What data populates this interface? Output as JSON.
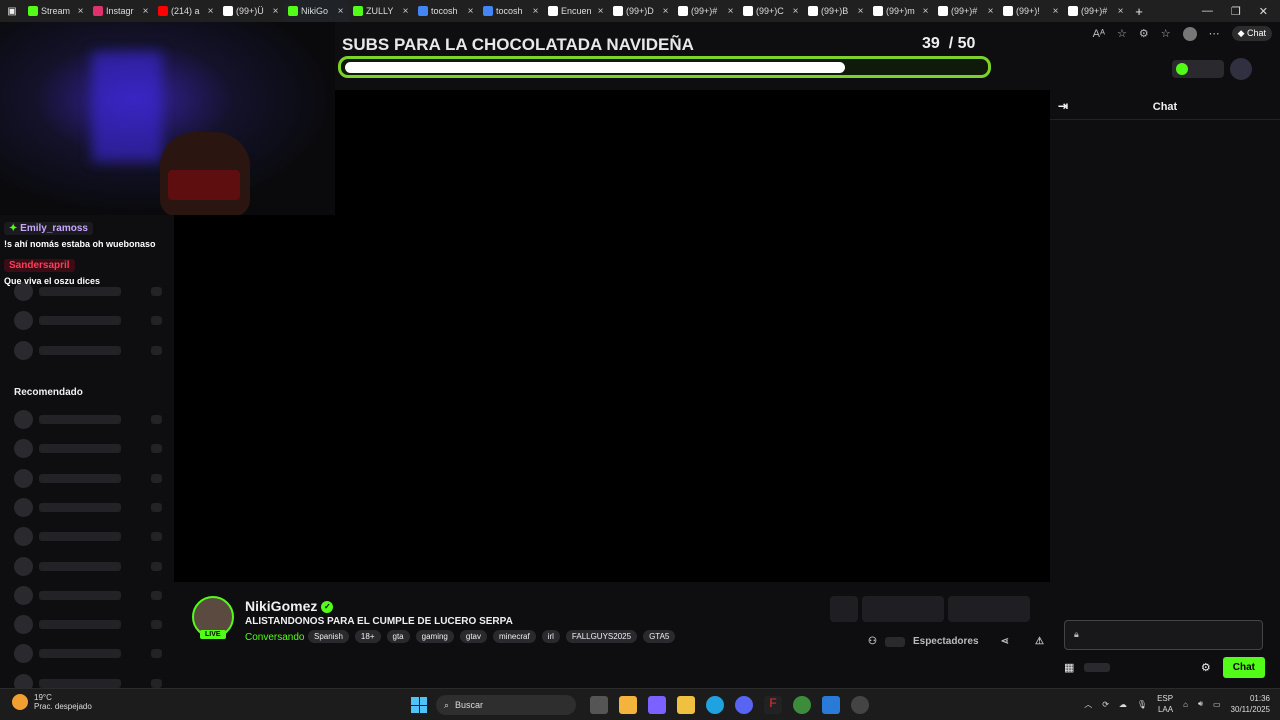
{
  "browser": {
    "tabs": [
      {
        "title": "Stream",
        "color": "#53fc18"
      },
      {
        "title": "Instagr",
        "color": "#e1306c"
      },
      {
        "title": "(214) a",
        "color": "#ff0000"
      },
      {
        "title": "(99+)Ü",
        "color": "#ffffff"
      },
      {
        "title": "NikiGo",
        "color": "#53fc18",
        "active": true
      },
      {
        "title": "ZULLY",
        "color": "#53fc18"
      },
      {
        "title": "tocosh",
        "color": "#4285f4"
      },
      {
        "title": "tocosh",
        "color": "#4285f4"
      },
      {
        "title": "Encuen",
        "color": "#ffffff"
      },
      {
        "title": "(99+)D",
        "color": "#ffffff"
      },
      {
        "title": "(99+)#",
        "color": "#ffffff"
      },
      {
        "title": "(99+)C",
        "color": "#ffffff"
      },
      {
        "title": "(99+)B",
        "color": "#ffffff"
      },
      {
        "title": "(99+)m",
        "color": "#ffffff"
      },
      {
        "title": "(99+)#",
        "color": "#ffffff"
      },
      {
        "title": "(99+)!",
        "color": "#ffffff"
      },
      {
        "title": "(99+)#",
        "color": "#ffffff"
      }
    ],
    "copilot_label": "Chat"
  },
  "goal": {
    "title": "SUBS PARA LA CHOCOLATADA NAVIDEÑA",
    "current": "39",
    "separator": "/",
    "target": "50",
    "fraction": 0.78
  },
  "overlay_chat": [
    {
      "user": "Emily_ramoss",
      "user_color": "#c7a6ff",
      "message": "!s ahí nomás estaba oh wuebonaso"
    },
    {
      "user": "Sandersapril",
      "user_color": "#ff3c5a",
      "message": "Que viva el oszu dices"
    }
  ],
  "sidebar": {
    "recommended_label": "Recomendado"
  },
  "chat": {
    "title": "Chat",
    "send_label": "Chat"
  },
  "streamer": {
    "name": "NikiGomez",
    "title": "ALISTANDONOS PARA EL CUMPLE DE LUCERO SERPA",
    "category": "Conversando",
    "live_label": "LIVE",
    "tags": [
      "Spanish",
      "18+",
      "gta",
      "gaming",
      "gtav",
      "minecraf",
      "irl",
      "FALLGUYS2025",
      "GTA5"
    ],
    "viewers_label": "Espectadores"
  },
  "taskbar": {
    "temperature": "19°C",
    "weather": "Prac. despejado",
    "search_label": "Buscar",
    "lang_top": "ESP",
    "lang_bottom": "LAA",
    "time": "01:36",
    "date": "30/11/2025"
  }
}
